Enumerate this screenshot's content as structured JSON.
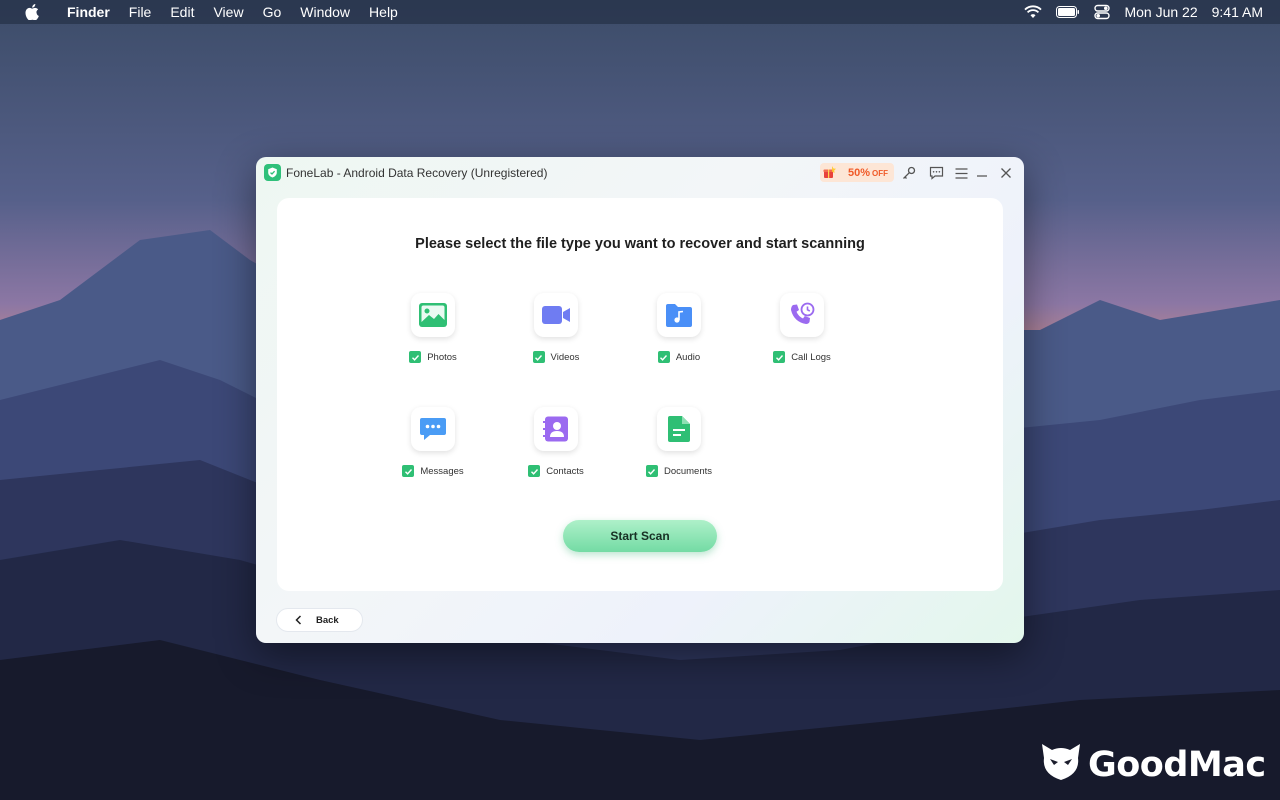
{
  "menubar": {
    "app_name": "Finder",
    "items": [
      "File",
      "Edit",
      "View",
      "Go",
      "Window",
      "Help"
    ],
    "clock": {
      "date": "Mon Jun 22",
      "time": "9:41 AM"
    },
    "icons": [
      "apple-icon",
      "wifi-icon",
      "battery-icon",
      "control-center-icon"
    ]
  },
  "window": {
    "title": "FoneLab - Android Data Recovery (Unregistered)",
    "promo": {
      "percent": "50%",
      "off": "OFF"
    },
    "toolbar_icons": [
      "key-icon",
      "feedback-icon",
      "menu-icon",
      "minimize-icon",
      "close-icon"
    ],
    "heading": "Please select the file type you want to recover and start scanning",
    "file_types": [
      {
        "label": "Photos",
        "icon": "photo-icon",
        "checked": true,
        "color": "#2fbf74"
      },
      {
        "label": "Videos",
        "icon": "video-icon",
        "checked": true,
        "color": "#6f7cf2"
      },
      {
        "label": "Audio",
        "icon": "audio-icon",
        "checked": true,
        "color": "#4a8ff7"
      },
      {
        "label": "Call Logs",
        "icon": "call-log-icon",
        "checked": true,
        "color": "#9b6af0"
      },
      {
        "label": "Messages",
        "icon": "message-icon",
        "checked": true,
        "color": "#4a9cf5"
      },
      {
        "label": "Contacts",
        "icon": "contact-icon",
        "checked": true,
        "color": "#9b6af0"
      },
      {
        "label": "Documents",
        "icon": "document-icon",
        "checked": true,
        "color": "#2fbf74"
      }
    ],
    "start_scan": "Start Scan",
    "back": "Back"
  },
  "watermark": "GoodMac",
  "colors": {
    "accent": "#2fbf74",
    "promo": "#f05a28"
  }
}
